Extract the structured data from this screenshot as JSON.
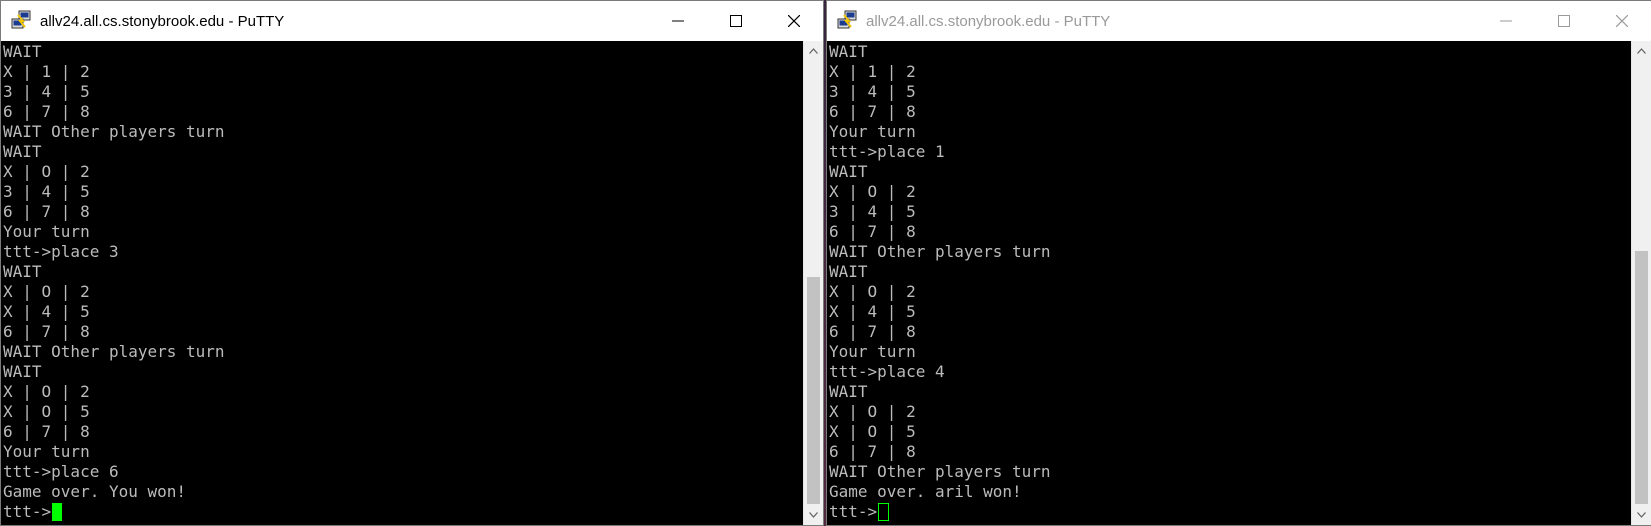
{
  "colors": {
    "terminal_bg": "#000000",
    "terminal_text": "#bbbbbb",
    "cursor": "#00ff00",
    "titlebar_bg": "#ffffff",
    "title_active": "#000000",
    "title_inactive": "#9a9a9a"
  },
  "icons": {
    "app": "putty-icon",
    "minimize": "minimize-icon",
    "maximize": "maximize-icon",
    "close": "close-icon",
    "scroll_up": "chevron-up-icon",
    "scroll_down": "chevron-down-icon"
  },
  "left_window": {
    "title": "allv24.all.cs.stonybrook.edu - PuTTY",
    "active": true,
    "lines": [
      "WAIT",
      "X | 1 | 2",
      "3 | 4 | 5",
      "6 | 7 | 8",
      "WAIT Other players turn",
      "WAIT",
      "X | O | 2",
      "3 | 4 | 5",
      "6 | 7 | 8",
      "Your turn",
      "ttt->place 3",
      "WAIT",
      "X | O | 2",
      "X | 4 | 5",
      "6 | 7 | 8",
      "WAIT Other players turn",
      "WAIT",
      "X | O | 2",
      "X | O | 5",
      "6 | 7 | 8",
      "Your turn",
      "ttt->place 6",
      "Game over. You won!"
    ],
    "prompt": "ttt->"
  },
  "right_window": {
    "title": "allv24.all.cs.stonybrook.edu - PuTTY",
    "active": false,
    "lines": [
      "WAIT",
      "X | 1 | 2",
      "3 | 4 | 5",
      "6 | 7 | 8",
      "Your turn",
      "ttt->place 1",
      "WAIT",
      "X | O | 2",
      "3 | 4 | 5",
      "6 | 7 | 8",
      "WAIT Other players turn",
      "WAIT",
      "X | O | 2",
      "X | 4 | 5",
      "6 | 7 | 8",
      "Your turn",
      "ttt->place 4",
      "WAIT",
      "X | O | 2",
      "X | O | 5",
      "6 | 7 | 8",
      "WAIT Other players turn",
      "Game over. aril won!"
    ],
    "prompt": "ttt->"
  }
}
